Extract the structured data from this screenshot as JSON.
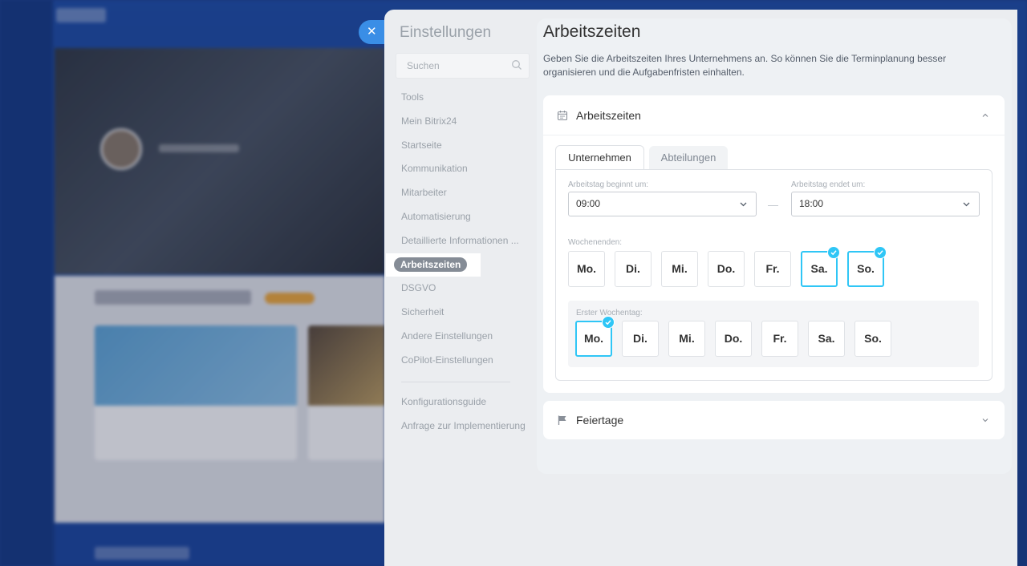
{
  "settings": {
    "title": "Einstellungen",
    "search_placeholder": "Suchen",
    "nav": [
      "Tools",
      "Mein Bitrix24",
      "Startseite",
      "Kommunikation",
      "Mitarbeiter",
      "Automatisierung",
      "Detaillierte Informationen ...",
      "Arbeitszeiten",
      "DSGVO",
      "Sicherheit",
      "Andere Einstellungen",
      "CoPilot-Einstellungen"
    ],
    "active_index": 7,
    "nav_secondary": [
      "Konfigurationsguide",
      "Anfrage zur Implementierung"
    ]
  },
  "page": {
    "title": "Arbeitszeiten",
    "description": "Geben Sie die Arbeitszeiten Ihres Unternehmens an. So können Sie die Terminplanung besser organisieren und die Aufgabenfristen einhalten."
  },
  "hours_card": {
    "title": "Arbeitszeiten",
    "tabs": [
      "Unternehmen",
      "Abteilungen"
    ],
    "active_tab": 0,
    "start_label": "Arbeitstag beginnt um:",
    "start_value": "09:00",
    "end_label": "Arbeitstag endet um:",
    "end_value": "18:00",
    "weekends_label": "Wochenenden:",
    "weekend_days": [
      "Mo.",
      "Di.",
      "Mi.",
      "Do.",
      "Fr.",
      "Sa.",
      "So."
    ],
    "weekend_selected": [
      false,
      false,
      false,
      false,
      false,
      true,
      true
    ],
    "first_day_label": "Erster Wochentag:",
    "first_days": [
      "Mo.",
      "Di.",
      "Mi.",
      "Do.",
      "Fr.",
      "Sa.",
      "So."
    ],
    "first_day_selected": [
      true,
      false,
      false,
      false,
      false,
      false,
      false
    ]
  },
  "holidays_card": {
    "title": "Feiertage"
  },
  "colors": {
    "accent": "#2fc6f6",
    "close_button": "#3a8ee6",
    "active_pill": "#858c96"
  },
  "icons": {
    "close": "close-icon",
    "search": "search-icon",
    "calendar": "calendar-icon",
    "flag": "flag-icon",
    "chevron_up": "chevron-up-icon",
    "chevron_down": "chevron-down-icon",
    "check": "check-icon"
  }
}
